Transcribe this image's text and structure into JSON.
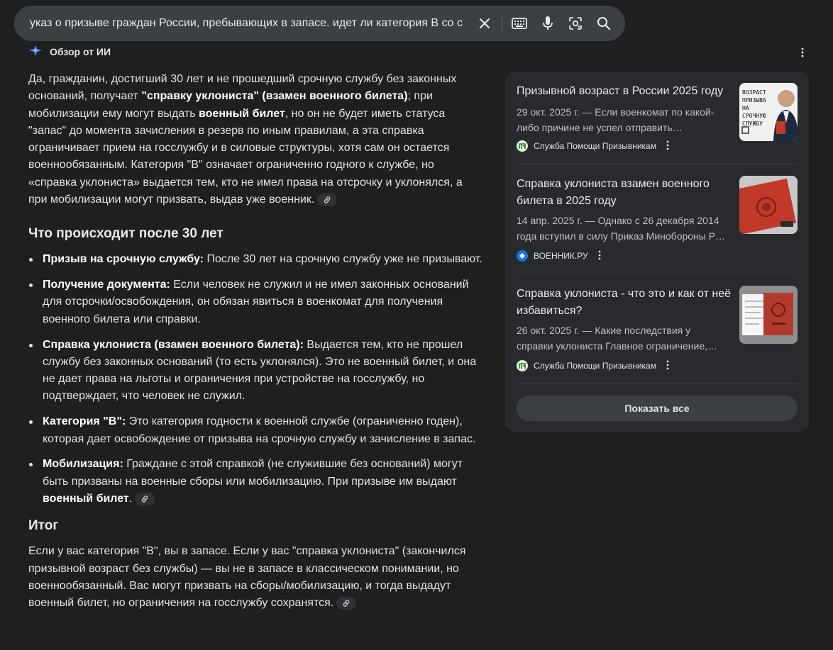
{
  "search": {
    "query": "указ о призыве граждан России, пребывающих в запасе. идет ли категория В со с",
    "icons": [
      "close-icon",
      "keyboard-icon",
      "mic-icon",
      "lens-icon",
      "search-icon"
    ]
  },
  "overview": {
    "title": "Обзор от ИИ",
    "icon": "sparkle-icon",
    "intro": [
      {
        "t": "Да, гражданин, достигший 30 лет и не прошедший срочную службу без законных оснований, получает ",
        "b": false
      },
      {
        "t": "\"справку уклониста\" (взамен военного билета)",
        "b": true
      },
      {
        "t": "; при мобилизации ему могут выдать ",
        "b": false
      },
      {
        "t": "военный билет",
        "b": true
      },
      {
        "t": ", но он не будет иметь статуса \"запас\" до момента зачисления в резерв по иным правилам, а эта справка ограничивает прием на госслужбу и в силовые структуры, хотя сам он остается военнообязанным. Категория \"В\" означает ограниченно годного к службе, но «справка уклониста» выдается тем, кто не имел права на отсрочку и уклонялся, а при мобилизации могут призвать, выдав уже военник.",
        "b": false
      }
    ],
    "section1_title": "Что происходит после 30 лет",
    "bullets": [
      {
        "label": "Призыв на срочную службу:",
        "text": " После 30 лет на срочную службу уже не призывают."
      },
      {
        "label": "Получение документа:",
        "text": " Если человек не служил и не имел законных оснований для отсрочки/освобождения, он обязан явиться в военкомат для получения военного билета или справки."
      },
      {
        "label": "Справка уклониста (взамен военного билета):",
        "text": " Выдается тем, кто не прошел службу без законных оснований (то есть уклонялся). Это не военный билет, и она не дает права на льготы и ограничения при устройстве на госслужбу, но подтверждает, что человек не служил."
      },
      {
        "label": "Категория \"В\":",
        "text": " Это категория годности к военной службе (ограниченно годен), которая дает освобождение от призыва на срочную службу и зачисление в запас."
      },
      {
        "label": "Мобилизация:",
        "text": " Граждане с этой справкой (не служившие без оснований) могут быть призваны на военные сборы или мобилизацию. При призыве им выдают ",
        "tail_bold": "военный билет",
        "tail": "."
      }
    ],
    "section2_title": "Итог",
    "summary": "Если у вас категория \"В\", вы в запасе. Если у вас \"справка уклониста\" (закончился призывной возраст без службы) — вы не в запасе в классическом понимании, но военнообязанный. Вас могут призвать на сборы/мобилизацию, и тогда выдадут военный билет, но ограничения на госслужбу сохранятся."
  },
  "sources": [
    {
      "title": "Призывной возраст в России 2025 году",
      "snippet": "29 окт. 2025 г. — Если военкомат по какой-либо причине не успел отправить…",
      "site": "Служба Помощи Призывникам",
      "thumb_text": "ВОЗРАСТ ПРИЗЫВА НА СРОЧНУЮ СЛУЖБУ"
    },
    {
      "title": "Справка уклониста взамен военного билета в 2025 году",
      "snippet": "14 апр. 2025 г. — Однако с 26 декабря 2014 года вступил в силу Приказ Минобороны Р…",
      "site": "ВОЕННИК.РУ"
    },
    {
      "title": "Справка уклониста - что это и как от неё избавиться?",
      "snippet": "26 окт. 2025 г. — Какие последствия у справки уклониста Главное ограничение,…",
      "site": "Служба Помощи Призывникам"
    }
  ],
  "show_all_label": "Показать все",
  "colors": {
    "background": "#1f1f1f",
    "searchbar": "#3c4043",
    "panel": "#282a2e",
    "text": "#e3e3e3"
  }
}
